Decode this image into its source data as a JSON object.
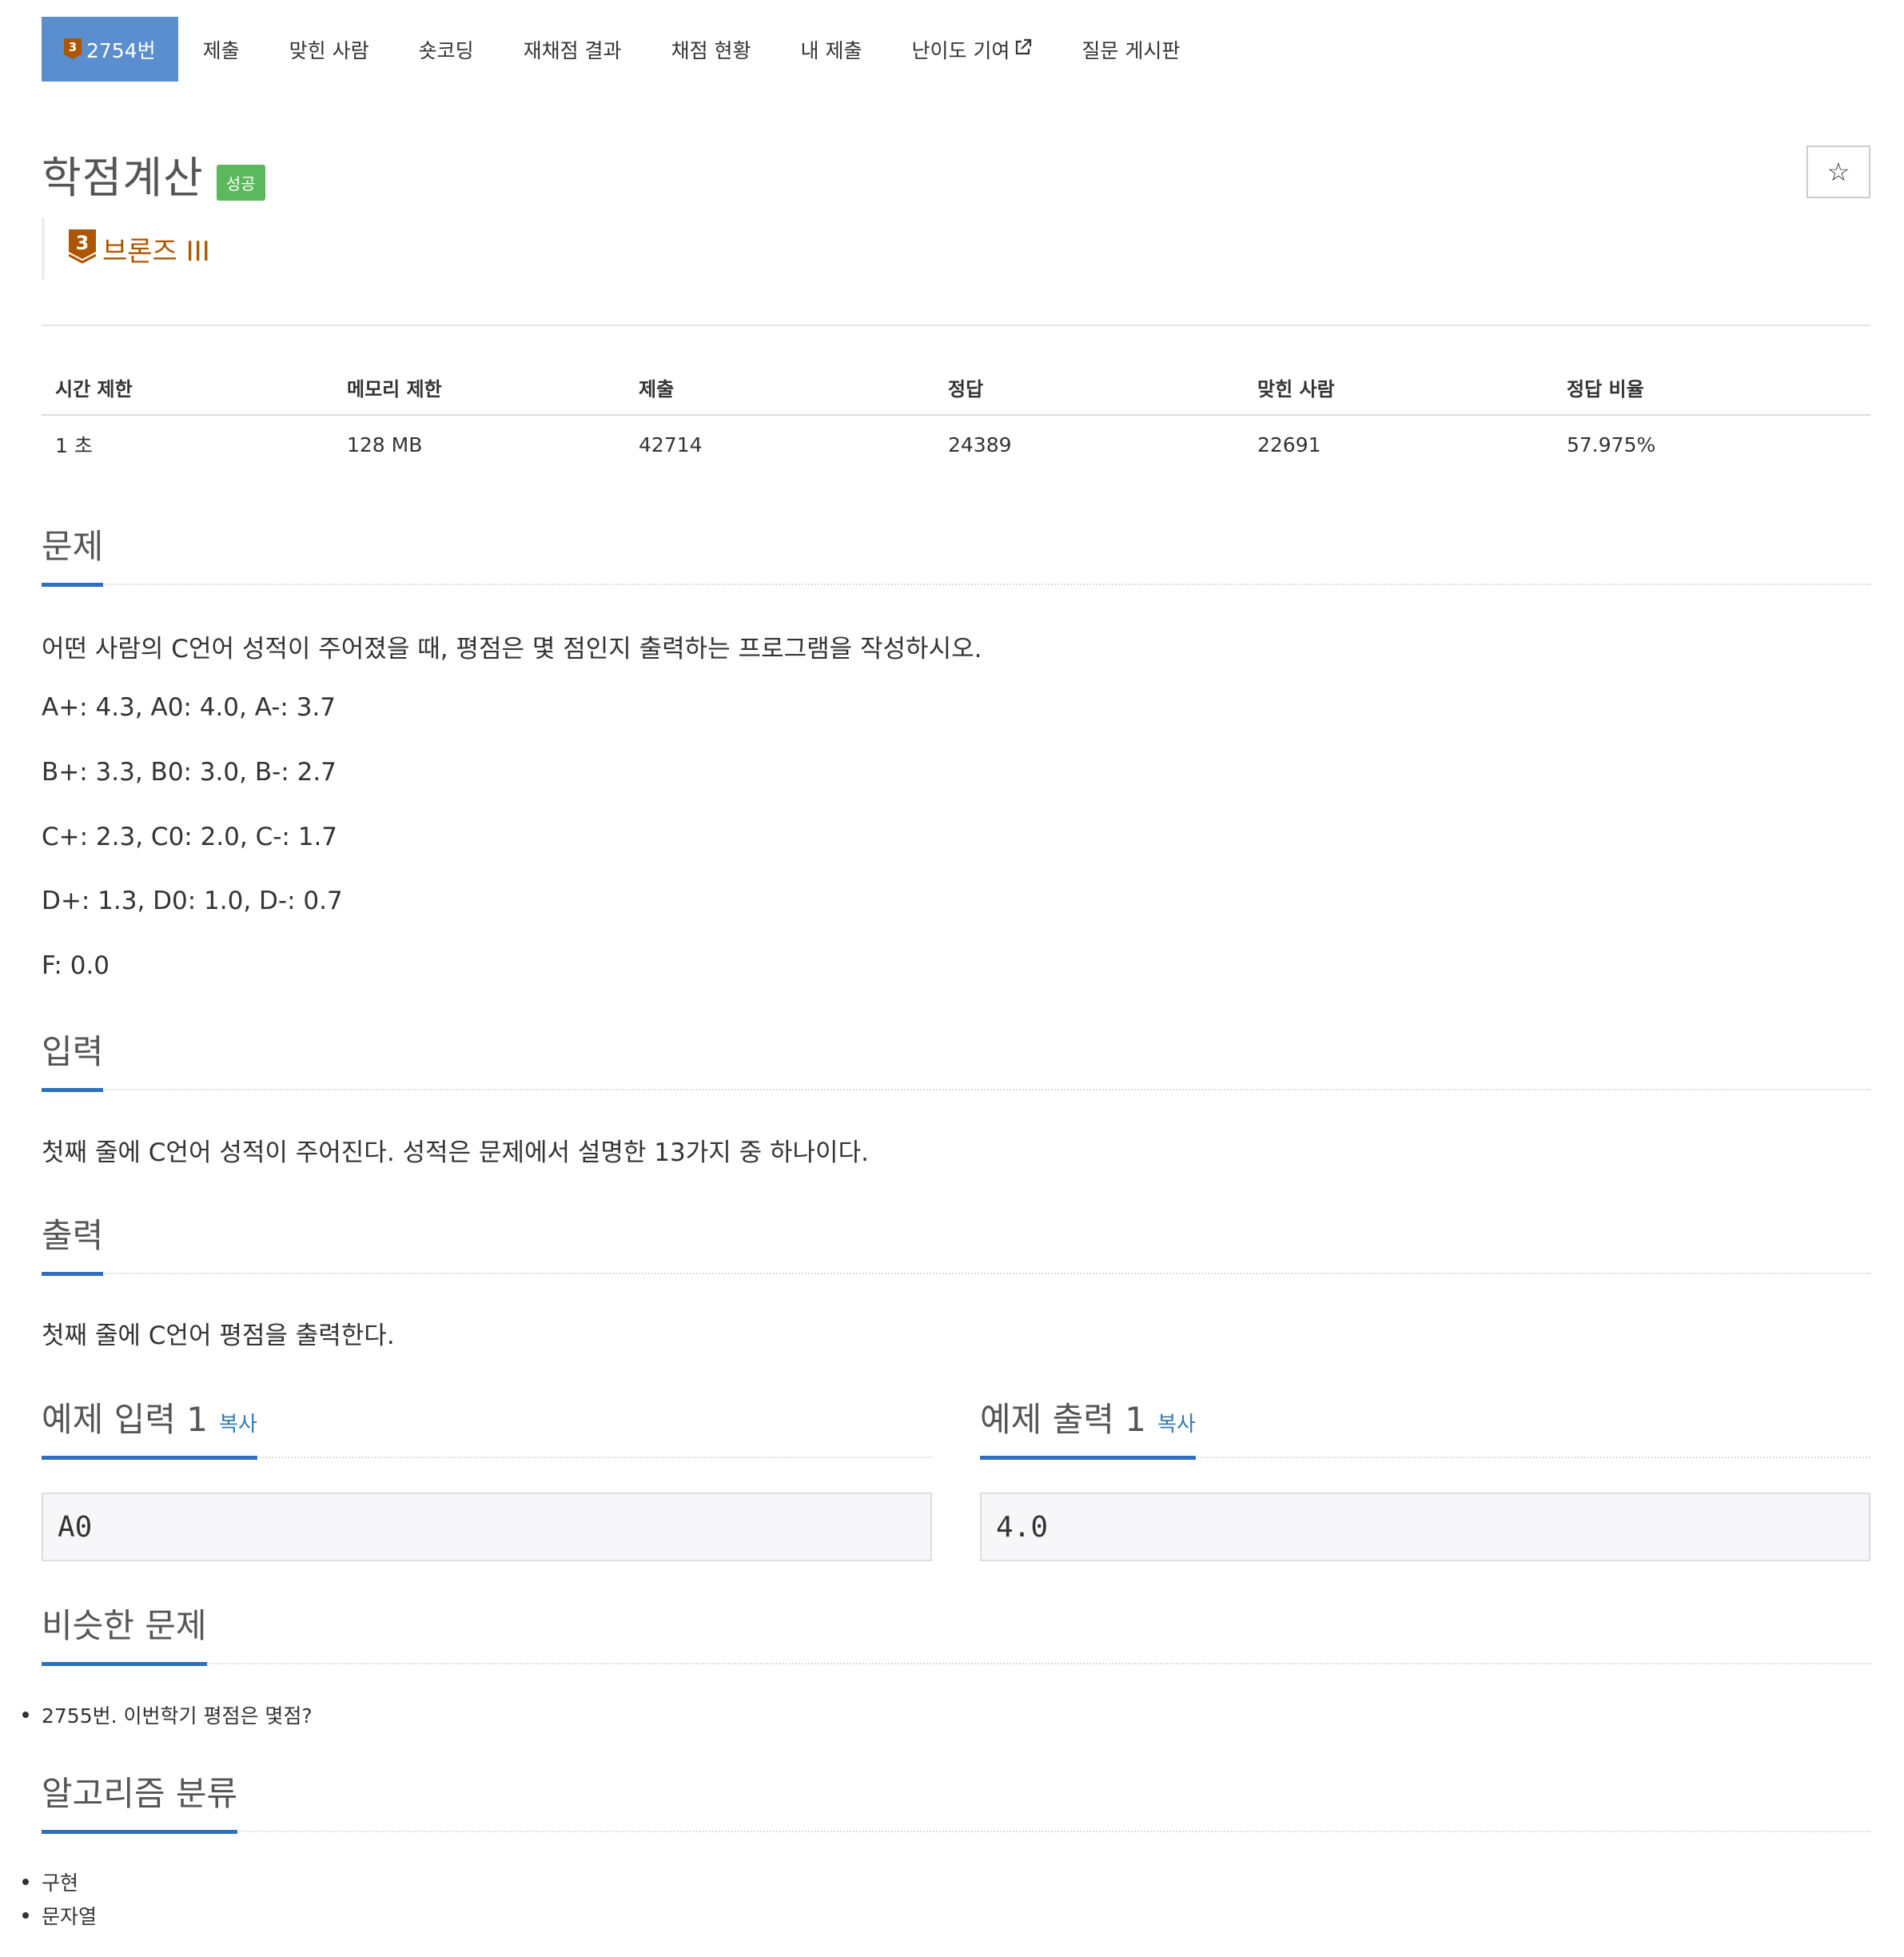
{
  "nav": {
    "problem_number": "2754번",
    "tier_digit": "3",
    "items": [
      {
        "label": "제출"
      },
      {
        "label": "맞힌 사람"
      },
      {
        "label": "숏코딩"
      },
      {
        "label": "재채점 결과"
      },
      {
        "label": "채점 현황"
      },
      {
        "label": "내 제출"
      },
      {
        "label": "난이도 기여"
      },
      {
        "label": "질문 게시판"
      }
    ]
  },
  "problem": {
    "title": "학점계산",
    "status_badge": "성공",
    "star": "☆",
    "tier_digit": "3",
    "tier_label": "브론즈 III",
    "tier_color": "#ad5600"
  },
  "info": {
    "headers": [
      "시간 제한",
      "메모리 제한",
      "제출",
      "정답",
      "맞힌 사람",
      "정답 비율"
    ],
    "values": [
      "1 초",
      "128 MB",
      "42714",
      "24389",
      "22691",
      "57.975%"
    ]
  },
  "sections": {
    "description_title": "문제",
    "description": [
      "어떤 사람의 C언어 성적이 주어졌을 때, 평점은 몇 점인지 출력하는 프로그램을 작성하시오.",
      "A+: 4.3, A0: 4.0, A-: 3.7",
      "B+: 3.3, B0: 3.0, B-: 2.7",
      "C+: 2.3, C0: 2.0, C-: 1.7",
      "D+: 1.3, D0: 1.0, D-: 0.7",
      "F: 0.0"
    ],
    "input_title": "입력",
    "input_text": "첫째 줄에 C언어 성적이 주어진다. 성적은 문제에서 설명한 13가지 중 하나이다.",
    "output_title": "출력",
    "output_text": "첫째 줄에 C언어 평점을 출력한다."
  },
  "samples": {
    "input_title": "예제 입력 1",
    "output_title": "예제 출력 1",
    "copy_label": "복사",
    "input_value": "A0",
    "output_value": "4.0"
  },
  "similar": {
    "title": "비슷한 문제",
    "items": [
      "2755번. 이번학기 평점은 몇점?"
    ]
  },
  "algorithms": {
    "title": "알고리즘 분류",
    "items": [
      "구현",
      "문자열"
    ]
  },
  "colors": {
    "active_tab": "#5b8ecf",
    "success": "#5cb85c",
    "section_underline": "#2e6fbf",
    "link": "#337ab7"
  }
}
